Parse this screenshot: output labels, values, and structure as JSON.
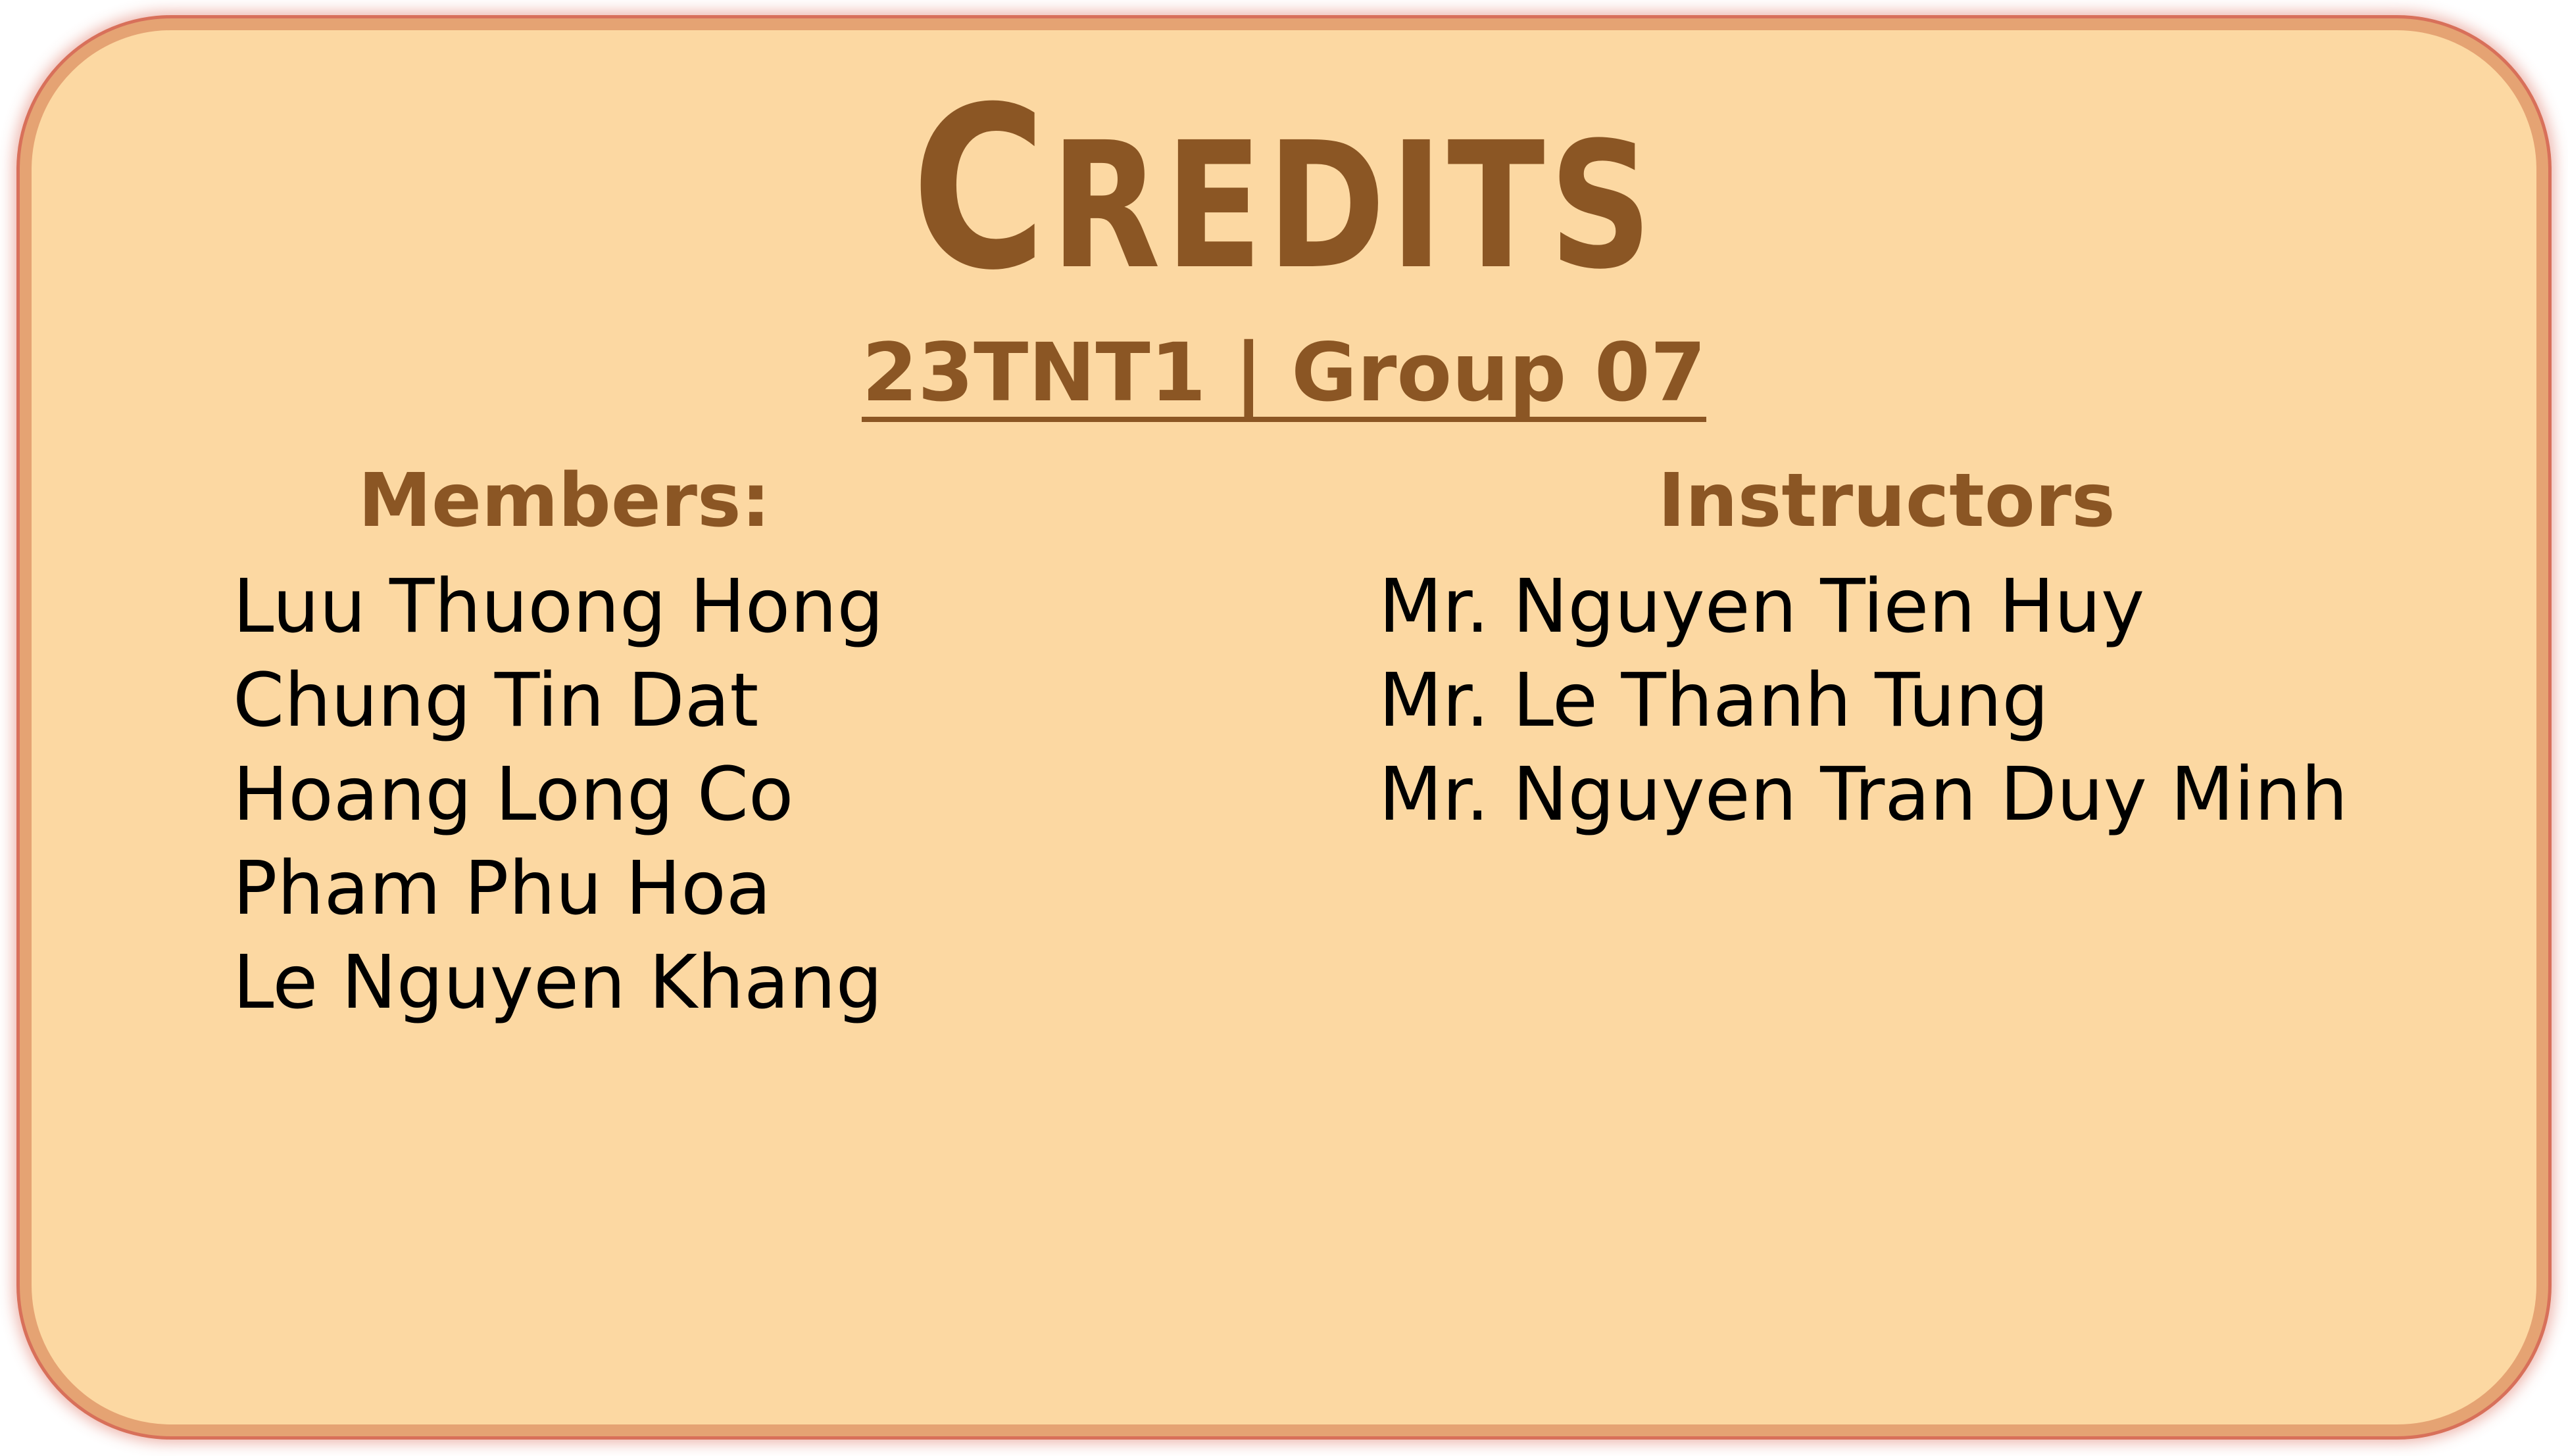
{
  "credits": {
    "title": "Credits",
    "subtitle": "23TNT1 | Group 07",
    "members_heading": "Members:",
    "instructors_heading": "Instructors",
    "members": [
      "Luu Thuong Hong",
      "Chung Tin Dat",
      "Hoang Long Co",
      "Pham Phu Hoa",
      "Le Nguyen Khang"
    ],
    "instructors": [
      "Mr. Nguyen Tien Huy",
      "Mr. Le Thanh Tung",
      "Mr. Nguyen Tran Duy Minh"
    ]
  },
  "colors": {
    "panel_fill": "#fcd8a2",
    "panel_border": "#e5a373",
    "panel_glow": "#d8705a",
    "heading_brown": "#8b5624",
    "name_text": "#000000"
  }
}
